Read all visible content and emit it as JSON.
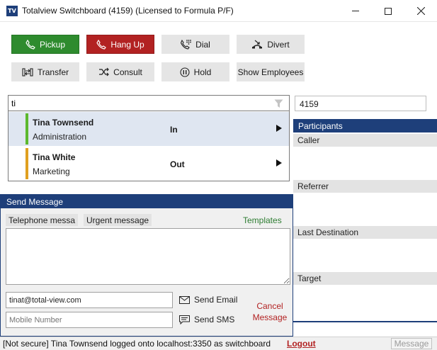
{
  "window": {
    "icon_text": "TV",
    "title": "Totalview Switchboard (4159) (Licensed to Formula P/F)"
  },
  "toolbar": {
    "pickup": "Pickup",
    "hangup": "Hang Up",
    "dial": "Dial",
    "divert": "Divert",
    "transfer": "Transfer",
    "consult": "Consult",
    "hold": "Hold",
    "show_employees": "Show Employees"
  },
  "search": {
    "value": "ti",
    "extension": "4159"
  },
  "results": [
    {
      "name": "Tina Townsend",
      "department": "Administration",
      "status": "In",
      "status_color": "#5cb82e"
    },
    {
      "name": "Tina White",
      "department": "Marketing",
      "status": "Out",
      "status_color": "#e0a020"
    }
  ],
  "participants": {
    "header": "Participants",
    "caller": "Caller",
    "referrer": "Referrer",
    "last_destination": "Last Destination",
    "target": "Target"
  },
  "send_message": {
    "title": "Send Message",
    "tab_telephone": "Telephone messa",
    "tab_urgent": "Urgent message",
    "templates": "Templates",
    "email_value": "tinat@total-view.com",
    "mobile_placeholder": "Mobile Number",
    "send_email": "Send Email",
    "send_sms": "Send SMS",
    "cancel_line1": "Cancel",
    "cancel_line2": "Message"
  },
  "statusbar": {
    "text": "[Not secure] Tina Townsend logged onto localhost:3350 as switchboard",
    "logout": "Logout",
    "message_button": "Message"
  },
  "colors": {
    "accent_navy": "#1e3f7a",
    "pickup_green": "#2e8b2e",
    "hangup_red": "#b22222"
  }
}
